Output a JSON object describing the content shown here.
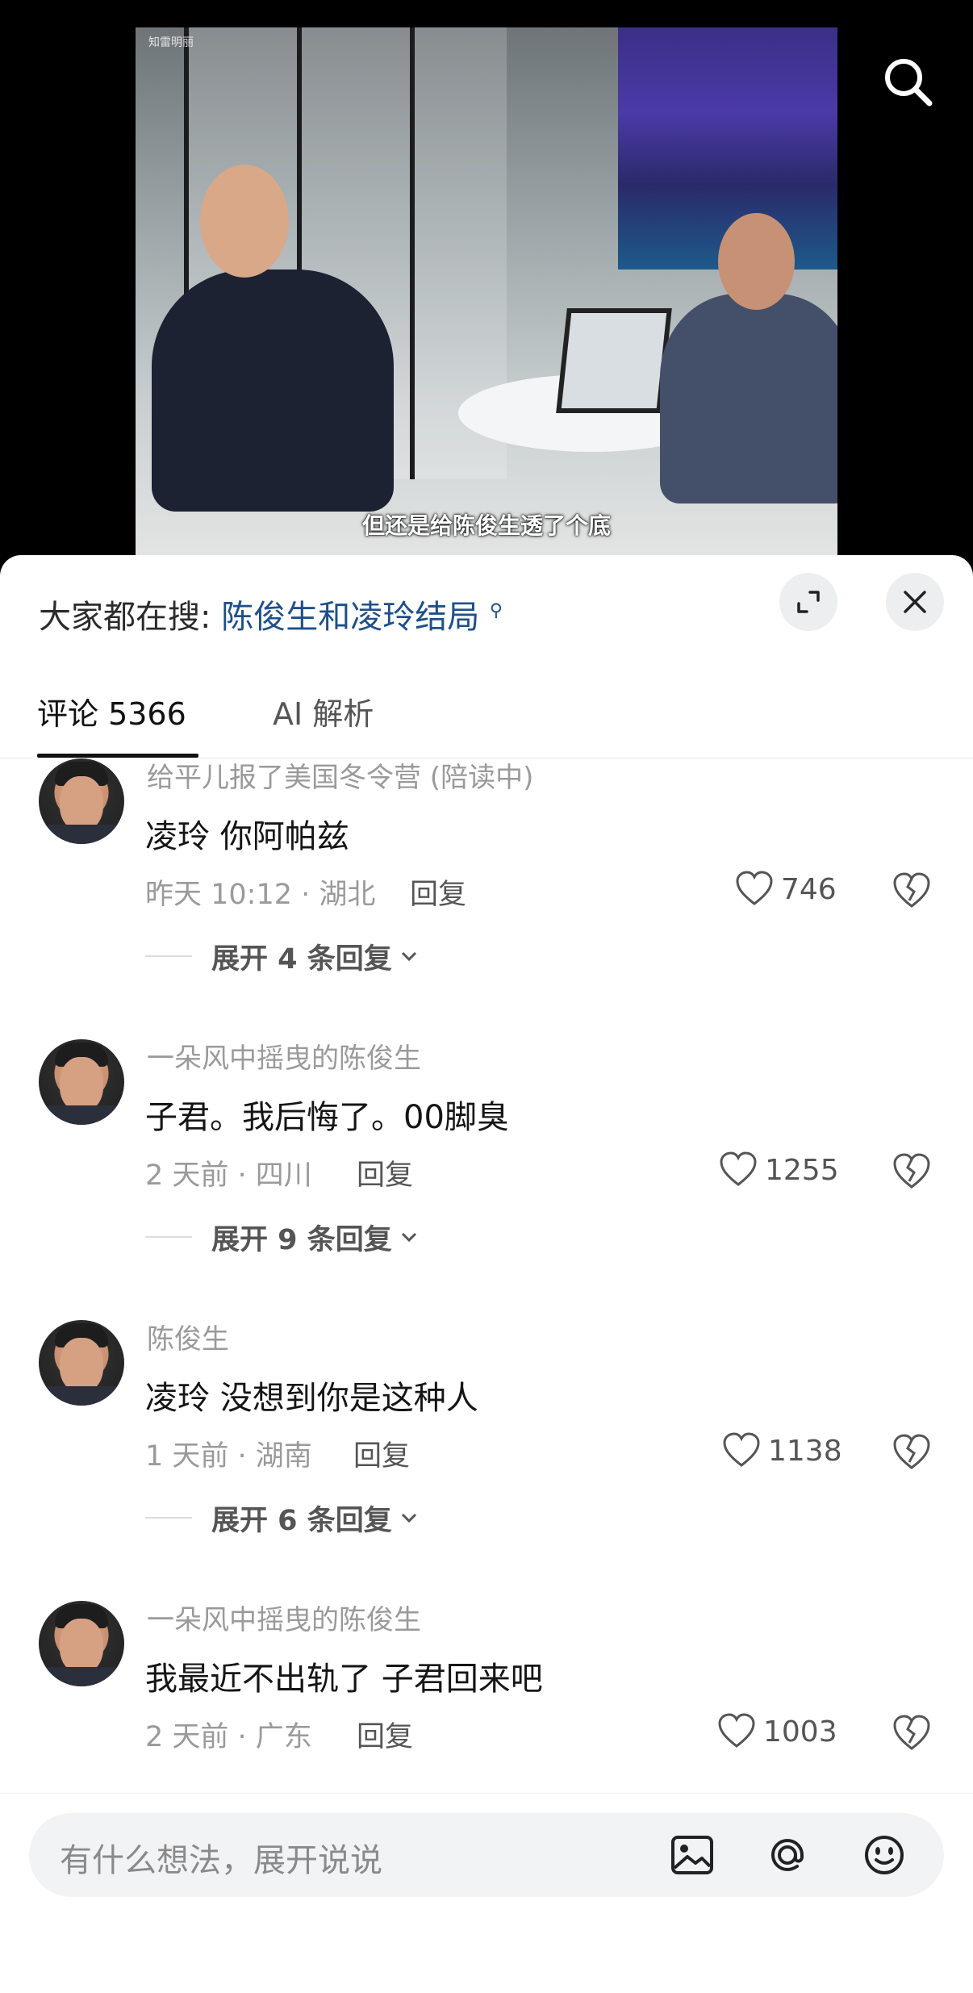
{
  "video": {
    "caption": "但还是给陈俊生透了个底",
    "watermark": "知雷明丽"
  },
  "sheet": {
    "search_hint_prefix": "大家都在搜:",
    "search_hint_query": "陈俊生和凌玲结局",
    "tabs": [
      {
        "label": "评论 5366",
        "active": true
      },
      {
        "label": "AI 解析",
        "active": false
      }
    ]
  },
  "comments": [
    {
      "name": "给平儿报了美国冬令营 (陪读中)",
      "text": "凌玲 你阿帕兹",
      "meta": "昨天 10:12 · 湖北",
      "reply": "回复",
      "likes": "746",
      "expand": "展开 4 条回复"
    },
    {
      "name": "一朵风中摇曳的陈俊生",
      "text": "子君。我后悔了。00脚臭",
      "meta": "2 天前 · 四川",
      "reply": "回复",
      "likes": "1255",
      "expand": "展开 9 条回复"
    },
    {
      "name": "陈俊生",
      "text": "凌玲 没想到你是这种人",
      "meta": "1 天前 · 湖南",
      "reply": "回复",
      "likes": "1138",
      "expand": "展开 6 条回复"
    },
    {
      "name": "一朵风中摇曳的陈俊生",
      "text": "我最近不出轨了 子君回来吧",
      "meta": "2 天前 · 广东",
      "reply": "回复",
      "likes": "1003",
      "expand": ""
    }
  ],
  "input": {
    "placeholder": "有什么想法，展开说说"
  },
  "icons": [
    "search-icon",
    "expand-icon",
    "close-icon",
    "heart-icon",
    "broken-heart-icon",
    "chevron-down-icon",
    "image-icon",
    "at-icon",
    "emoji-icon"
  ],
  "colors": {
    "link_blue": "#1f4f8b",
    "text_primary": "#151515",
    "text_secondary": "#9a9a9a"
  }
}
